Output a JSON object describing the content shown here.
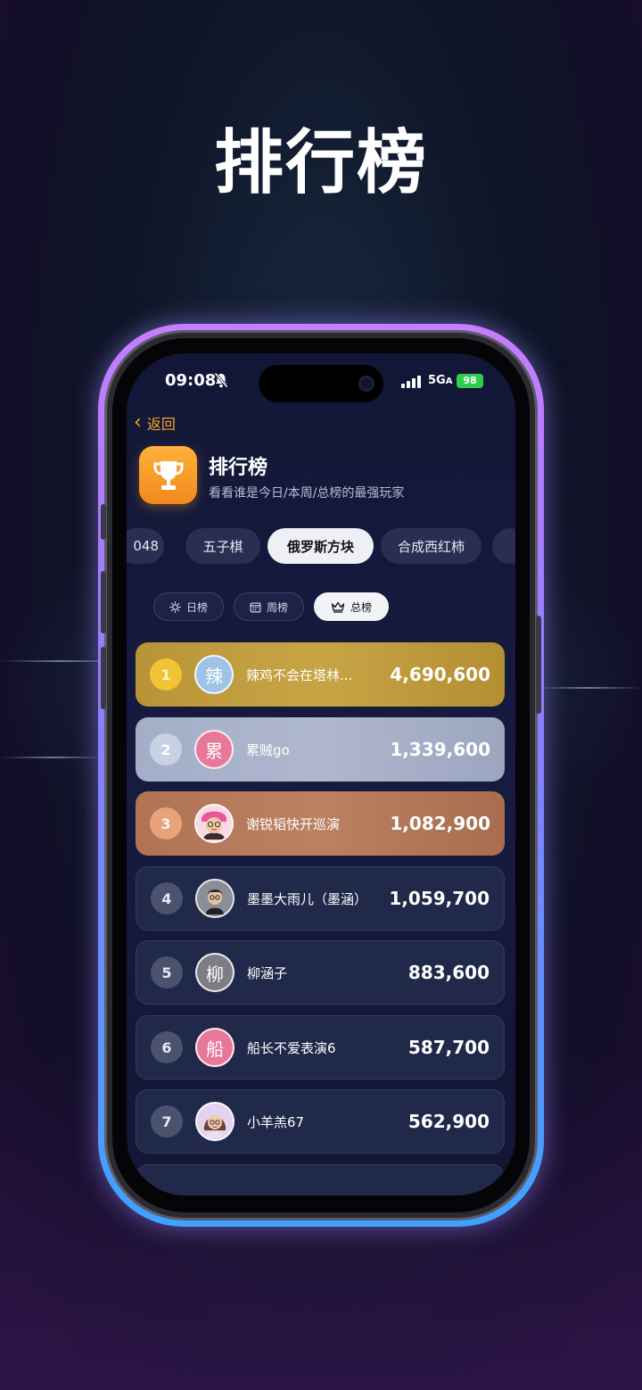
{
  "headline": "排行榜",
  "status_bar": {
    "time": "09:08",
    "network": "5G",
    "network_sub": "A",
    "battery": "98"
  },
  "back": {
    "label": "返回"
  },
  "header": {
    "title": "排行榜",
    "subtitle": "看看谁是今日/本周/总榜的最强玩家"
  },
  "game_tabs": [
    {
      "label": "048",
      "active": false
    },
    {
      "label": "五子棋",
      "active": false
    },
    {
      "label": "俄罗斯方块",
      "active": true
    },
    {
      "label": "合成西红柿",
      "active": false
    }
  ],
  "period_tabs": [
    {
      "label": "日榜",
      "icon": "sun-icon",
      "active": false
    },
    {
      "label": "周榜",
      "icon": "calendar-icon",
      "active": false
    },
    {
      "label": "总榜",
      "icon": "crown-icon",
      "active": true
    }
  ],
  "leaderboard": [
    {
      "rank": "1",
      "name": "辣鸡不会在塔林...",
      "avatar_char": "辣",
      "avatar_color": "#9fc3e6",
      "score": "4,690,600"
    },
    {
      "rank": "2",
      "name": "累贼go",
      "avatar_char": "累",
      "avatar_color": "#e8779a",
      "score": "1,339,600"
    },
    {
      "rank": "3",
      "name": "谢锐韬快开巡演",
      "avatar_char": "",
      "avatar_color": "#f5c6d4",
      "score": "1,082,900"
    },
    {
      "rank": "4",
      "name": "墨墨大雨儿（墨涵）",
      "avatar_char": "",
      "avatar_color": "#6b6f78",
      "score": "1,059,700"
    },
    {
      "rank": "5",
      "name": "柳涵子",
      "avatar_char": "柳",
      "avatar_color": "#7d7d85",
      "score": "883,600"
    },
    {
      "rank": "6",
      "name": "船长不爱表演6",
      "avatar_char": "船",
      "avatar_color": "#e8779a",
      "score": "587,700"
    },
    {
      "rank": "7",
      "name": "小羊羔67",
      "avatar_char": "",
      "avatar_color": "#d9c7ea",
      "score": "562,900"
    }
  ]
}
